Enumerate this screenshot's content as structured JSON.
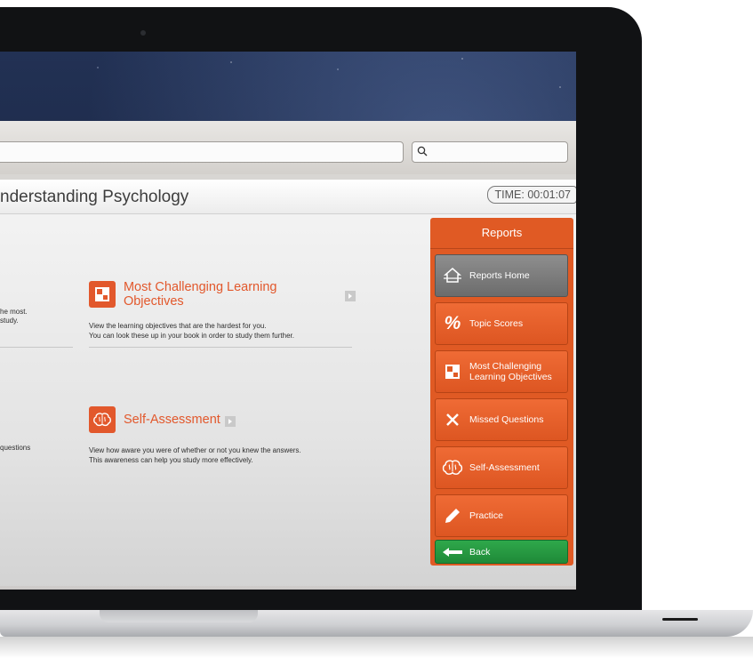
{
  "app": {
    "page_title": "nderstanding Psychology",
    "timer": "TIME: 00:01:07"
  },
  "cards": {
    "objectives": {
      "title": "Most Challenging Learning Objectives",
      "desc_line1": "View the learning objectives that are the hardest for you.",
      "desc_line2": "You can look these up in your book in order to study them further."
    },
    "self_assessment": {
      "title": "Self-Assessment",
      "desc_line1": "View how aware you were of whether or not you knew the answers.",
      "desc_line2": "This awareness can help you study more effectively."
    },
    "left_fragments": {
      "line1": "he most.",
      "line2": "study.",
      "line3": "questions"
    }
  },
  "reports_panel": {
    "heading": "Reports",
    "items": [
      {
        "label": "Reports Home",
        "icon": "house-icon",
        "active": true
      },
      {
        "label": "Topic Scores",
        "icon": "percent-icon"
      },
      {
        "label_line1": "Most Challenging",
        "label_line2": "Learning Objectives",
        "icon": "objectives-icon"
      },
      {
        "label": "Missed Questions",
        "icon": "x-icon"
      },
      {
        "label": "Self-Assessment",
        "icon": "brain-icon"
      },
      {
        "label": "Practice",
        "icon": "pencil-icon"
      }
    ],
    "back_label": "Back"
  },
  "colors": {
    "accent_orange": "#e2582c",
    "back_green": "#2fa84b",
    "active_gray": "#7d7d7d"
  }
}
